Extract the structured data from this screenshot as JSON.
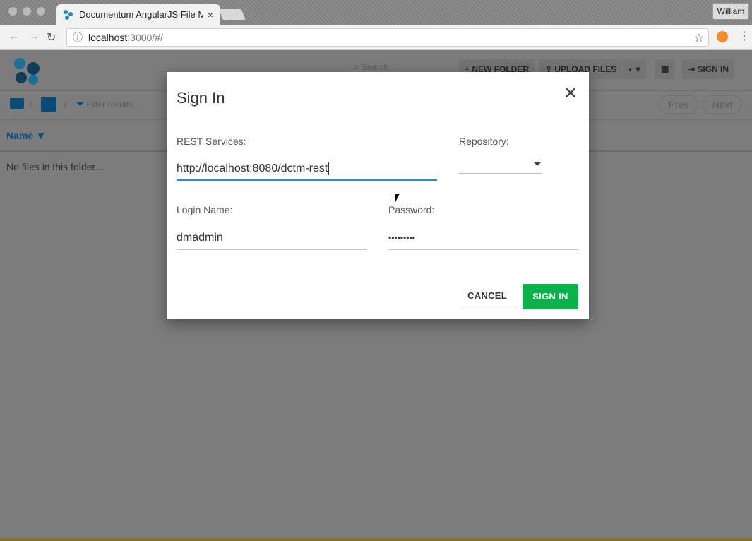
{
  "browser": {
    "tab_title": "Documentum AngularJS File M",
    "tab_close": "×",
    "user_button": "William",
    "address_host": "localhost",
    "address_path": ":3000/#/",
    "info_icon": "ⓘ",
    "back_icon": "←",
    "forward_icon": "→",
    "reload_icon": "↻",
    "star_icon": "☆",
    "menu_icon": "⋮"
  },
  "app": {
    "search_placeholder": "Search...",
    "search_icon": "⌕",
    "buttons": {
      "new_folder": "+ NEW FOLDER",
      "upload_files": "⇪ UPLOAD FILES",
      "language": "◐ ▾",
      "grid": "▦",
      "sign_in": "⇥ SIGN IN"
    },
    "filter_placeholder": "Filter results...",
    "filter_icon": "⏷",
    "prev": "Prev",
    "next": "Next",
    "column_name": "Name ▼",
    "empty_message": "No files in this folder..."
  },
  "dialog": {
    "title": "Sign In",
    "close_icon": "✕",
    "rest_label": "REST Services:",
    "rest_value": "http://localhost:8080/dctm-rest",
    "repository_label": "Repository:",
    "login_label": "Login Name:",
    "login_value": "dmadmin",
    "password_label": "Password:",
    "password_value": "•••••••••",
    "cancel_label": "CANCEL",
    "signin_label": "SIGN IN"
  },
  "colors": {
    "primary": "#1f8fd0",
    "success": "#0bb14a",
    "brand_dark": "#0c3e5a"
  }
}
